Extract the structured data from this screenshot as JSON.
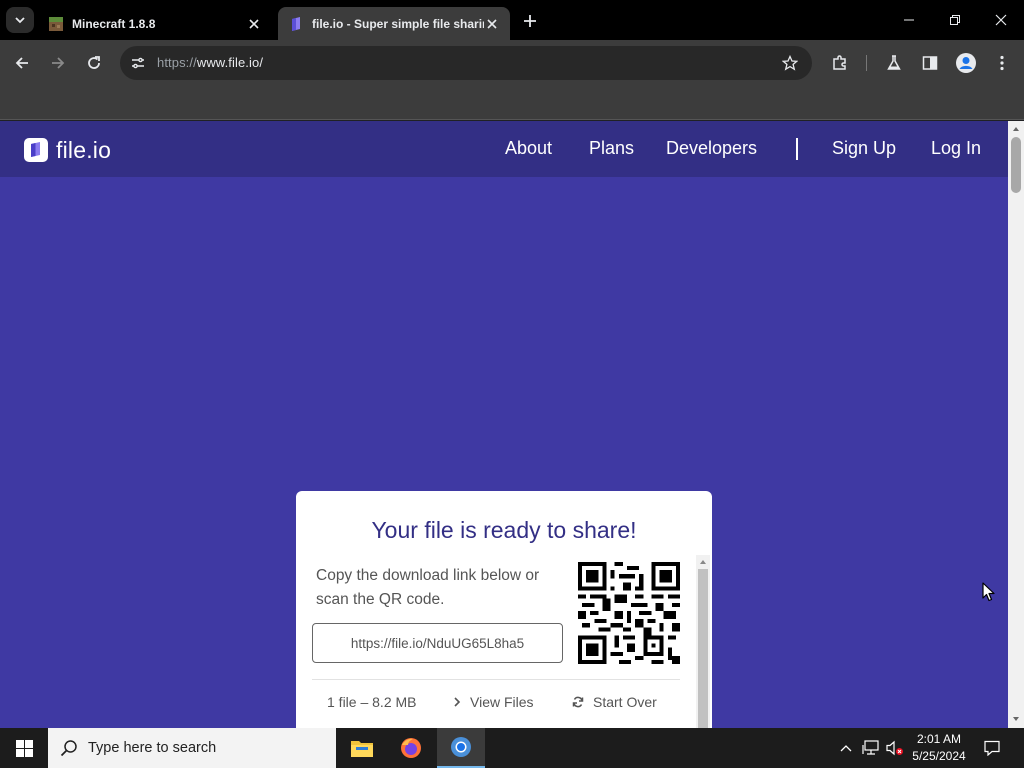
{
  "browser": {
    "tabs": [
      {
        "title": "Minecraft 1.8.8",
        "active": false
      },
      {
        "title": "file.io - Super simple file sharing",
        "active": true
      }
    ],
    "address": {
      "scheme": "https://",
      "host": "www.file.io/"
    }
  },
  "site": {
    "logo_text": "file.io",
    "nav": {
      "about": "About",
      "plans": "Plans",
      "developers": "Developers",
      "signup": "Sign Up",
      "login": "Log In"
    }
  },
  "card": {
    "title": "Your file is ready to share!",
    "description": "Copy the download link below or scan the QR code.",
    "link": "https://file.io/NduUG65L8ha5",
    "file_info": "1 file – 8.2 MB",
    "view_files": "View Files",
    "start_over": "Start Over"
  },
  "taskbar": {
    "search_placeholder": "Type here to search",
    "time": "2:01 AM",
    "date": "5/25/2024"
  },
  "colors": {
    "page_bg": "#3f39a3",
    "nav_bg": "#332f85",
    "title": "#332f85"
  }
}
